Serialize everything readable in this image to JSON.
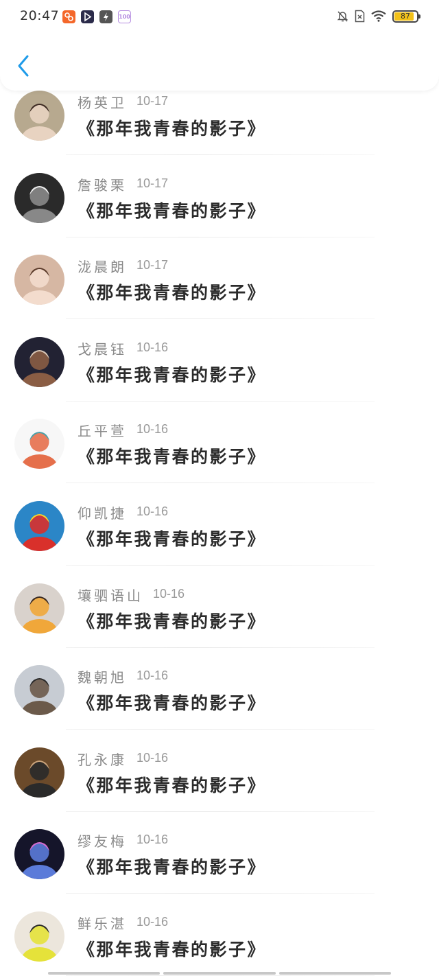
{
  "status_bar": {
    "time": "20:47",
    "battery_level": "87",
    "battery_fraction": 0.87,
    "app_icons": [
      "video-app-icon",
      "play-app-icon",
      "flash-app-icon",
      "score-100-app-icon"
    ],
    "score_badge": "100"
  },
  "header": {
    "back_icon": "chevron-left-icon",
    "accent_color": "#1e9be9"
  },
  "items": [
    {
      "name": "杨英卫",
      "date": "10-17",
      "title": "《那年我青春的影子》"
    },
    {
      "name": "詹骏栗",
      "date": "10-17",
      "title": "《那年我青春的影子》"
    },
    {
      "name": "泷晨朗",
      "date": "10-17",
      "title": "《那年我青春的影子》"
    },
    {
      "name": "戈晨钰",
      "date": "10-16",
      "title": "《那年我青春的影子》"
    },
    {
      "name": "丘平萱",
      "date": "10-16",
      "title": "《那年我青春的影子》"
    },
    {
      "name": "仰凯捷",
      "date": "10-16",
      "title": "《那年我青春的影子》"
    },
    {
      "name": "壤驷语山",
      "date": "10-16",
      "title": "《那年我青春的影子》"
    },
    {
      "name": "魏朝旭",
      "date": "10-16",
      "title": "《那年我青春的影子》"
    },
    {
      "name": "孔永康",
      "date": "10-16",
      "title": "《那年我青春的影子》"
    },
    {
      "name": "缪友梅",
      "date": "10-16",
      "title": "《那年我青春的影子》"
    },
    {
      "name": "鲜乐湛",
      "date": "10-16",
      "title": "《那年我青春的影子》"
    }
  ]
}
